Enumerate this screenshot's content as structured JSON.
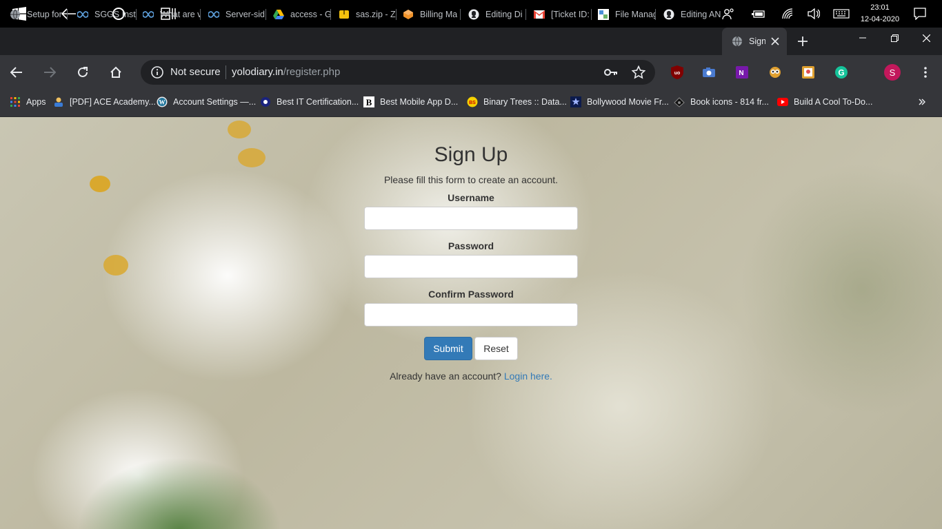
{
  "taskbar": {
    "time": "23:01",
    "date": "12-04-2020"
  },
  "tabs": [
    {
      "title": "Setup for ",
      "icon": "globe-icon"
    },
    {
      "title": "SGGS Insti",
      "icon": "infinity-icon"
    },
    {
      "title": "What are v",
      "icon": "infinity-icon"
    },
    {
      "title": "Server-sid",
      "icon": "infinity-icon"
    },
    {
      "title": "access - G",
      "icon": "google-drive-icon"
    },
    {
      "title": "sas.zip - Z",
      "icon": "zip-icon"
    },
    {
      "title": "Billing Ma",
      "icon": "aws-icon"
    },
    {
      "title": "Editing Di",
      "icon": "github-icon"
    },
    {
      "title": "[Ticket ID:",
      "icon": "gmail-icon"
    },
    {
      "title": "File Manag",
      "icon": "file-manager-icon"
    },
    {
      "title": "Editing AN",
      "icon": "github-icon"
    },
    {
      "title": "Sign",
      "icon": "globe-icon"
    }
  ],
  "omnibox": {
    "security": "Not secure",
    "domain": "yolodiary.in",
    "path": "/register.php"
  },
  "profile": {
    "initial": "S"
  },
  "bookmarks": [
    {
      "label": "Apps",
      "icon": "apps-grid-icon"
    },
    {
      "label": "[PDF] ACE Academy...",
      "icon": "ace-academy-icon"
    },
    {
      "label": "Account Settings —...",
      "icon": "wordpress-icon"
    },
    {
      "label": "Best IT Certification...",
      "icon": "certification-icon"
    },
    {
      "label": "Best Mobile App D...",
      "icon": "b-logo-icon"
    },
    {
      "label": "Binary Trees :: Data...",
      "icon": "binary-trees-icon"
    },
    {
      "label": "Bollywood Movie Fr...",
      "icon": "bollywood-icon"
    },
    {
      "label": "Book icons - 814 fr...",
      "icon": "book-icons-icon"
    },
    {
      "label": "Build A Cool To-Do...",
      "icon": "youtube-icon"
    }
  ],
  "form": {
    "title": "Sign Up",
    "subtitle": "Please fill this form to create an account.",
    "username_label": "Username",
    "username_value": "",
    "password_label": "Password",
    "password_value": "",
    "confirm_label": "Confirm Password",
    "confirm_value": "",
    "submit_label": "Submit",
    "reset_label": "Reset",
    "login_prompt": "Already have an account?",
    "login_link": "Login here."
  },
  "colors": {
    "primary": "#337ab7",
    "chrome_dark": "#202124",
    "chrome_toolbar": "#35363a",
    "profile": "#c2185b"
  }
}
